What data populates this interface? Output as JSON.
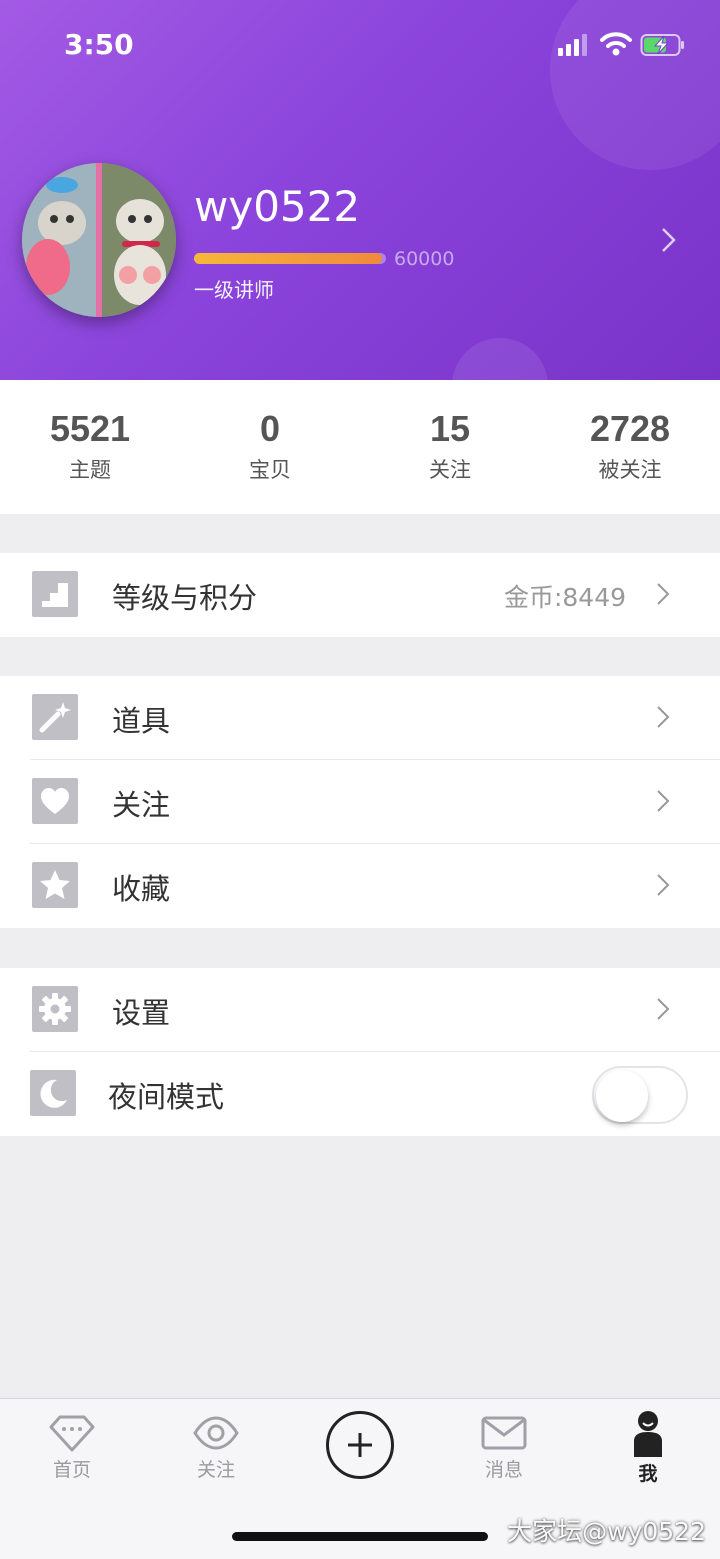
{
  "status_bar": {
    "time": "3:50"
  },
  "profile": {
    "username": "wy0522",
    "exp_max": "60000",
    "exp_progress": 0.98,
    "level": "一级讲师"
  },
  "stats": [
    {
      "value": "5521",
      "label": "主题"
    },
    {
      "value": "0",
      "label": "宝贝"
    },
    {
      "value": "15",
      "label": "关注"
    },
    {
      "value": "2728",
      "label": "被关注"
    }
  ],
  "menu": {
    "level": {
      "label": "等级与积分",
      "value": "金币:8449",
      "icon": "stairs-icon"
    },
    "props": {
      "label": "道具",
      "icon": "magic-wand-icon"
    },
    "follow": {
      "label": "关注",
      "icon": "heart-icon"
    },
    "favorites": {
      "label": "收藏",
      "icon": "star-icon"
    },
    "settings": {
      "label": "设置",
      "icon": "gear-icon"
    },
    "night_mode": {
      "label": "夜间模式",
      "icon": "moon-icon",
      "enabled": false
    }
  },
  "tabbar": [
    {
      "label": "首页",
      "icon": "diamond-icon"
    },
    {
      "label": "关注",
      "icon": "eye-icon"
    },
    {
      "label": "",
      "icon": "plus-icon"
    },
    {
      "label": "消息",
      "icon": "envelope-icon"
    },
    {
      "label": "我",
      "icon": "person-icon",
      "active": true
    }
  ],
  "watermark": "大家坛@wy0522",
  "colors": {
    "header_start": "#a35ae4",
    "header_end": "#7a33c8",
    "progress": "#f08a3c",
    "icon_bg": "#bfbfc5"
  }
}
